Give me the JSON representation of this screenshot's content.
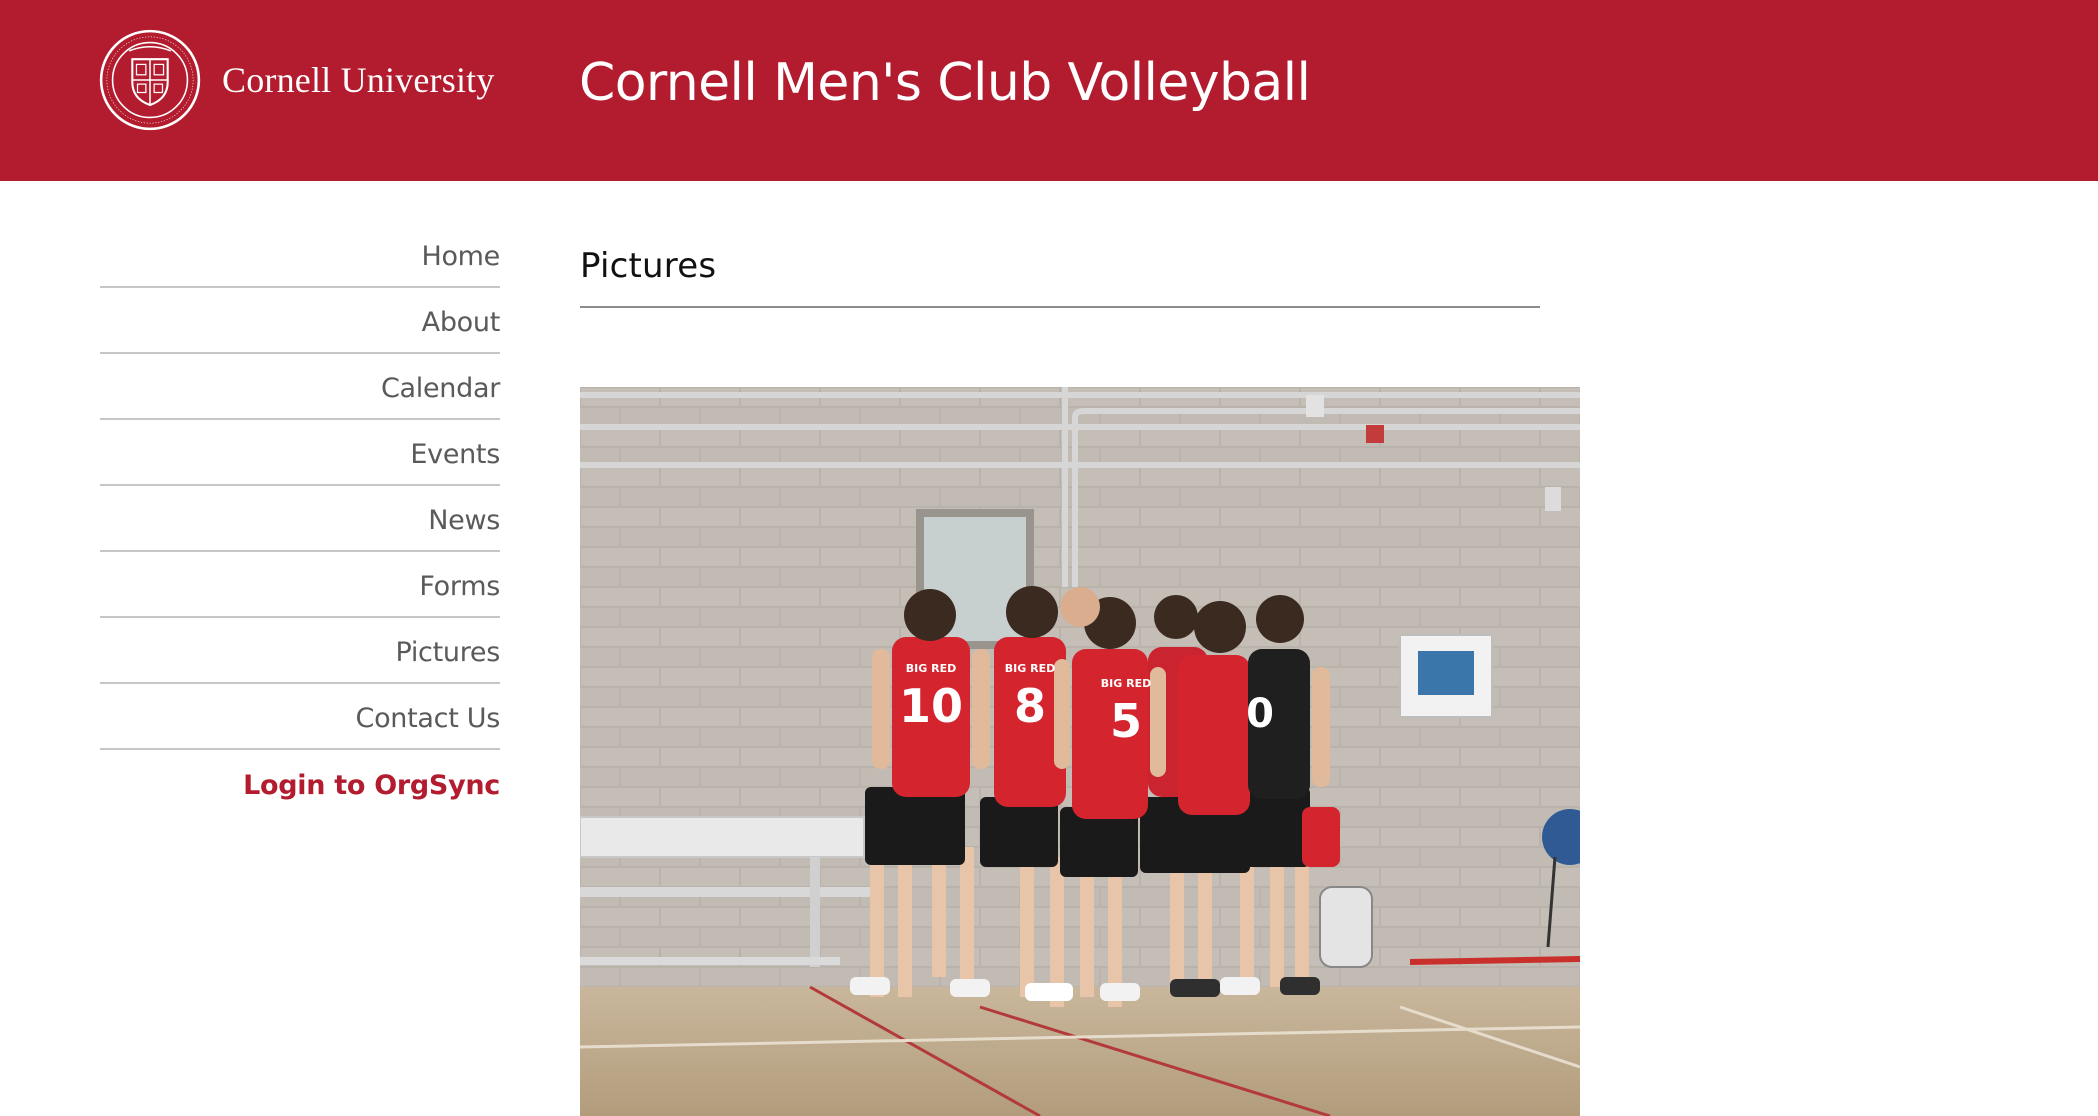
{
  "header": {
    "university_name": "Cornell University",
    "site_title": "Cornell Men's Club Volleyball",
    "seal_icon": "cornell-seal-icon",
    "background_color": "#b31b2e"
  },
  "nav": {
    "items": [
      {
        "label": "Home"
      },
      {
        "label": "About"
      },
      {
        "label": "Calendar"
      },
      {
        "label": "Events"
      },
      {
        "label": "News"
      },
      {
        "label": "Forms"
      },
      {
        "label": "Pictures"
      },
      {
        "label": "Contact Us"
      }
    ],
    "login_label": "Login to OrgSync",
    "login_color": "#b31b2e"
  },
  "main": {
    "page_title": "Pictures",
    "photo": {
      "jersey_text": "BIG RED",
      "jersey_numbers": [
        "10",
        "8",
        "5",
        "0"
      ]
    }
  }
}
